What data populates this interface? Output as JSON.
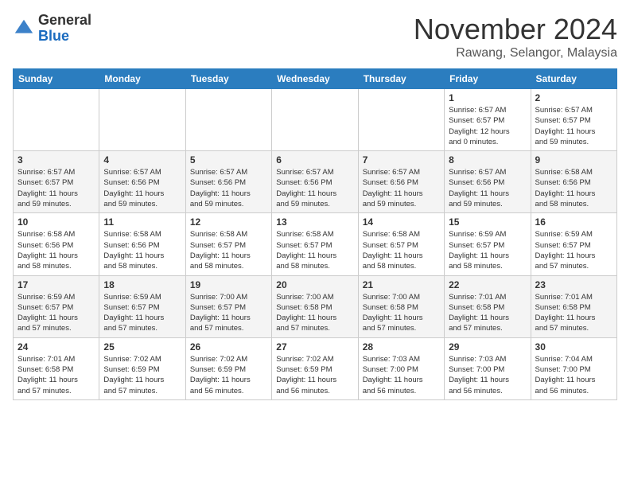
{
  "header": {
    "logo_general": "General",
    "logo_blue": "Blue",
    "month_title": "November 2024",
    "location": "Rawang, Selangor, Malaysia"
  },
  "days_of_week": [
    "Sunday",
    "Monday",
    "Tuesday",
    "Wednesday",
    "Thursday",
    "Friday",
    "Saturday"
  ],
  "weeks": [
    [
      {
        "day": "",
        "info": ""
      },
      {
        "day": "",
        "info": ""
      },
      {
        "day": "",
        "info": ""
      },
      {
        "day": "",
        "info": ""
      },
      {
        "day": "",
        "info": ""
      },
      {
        "day": "1",
        "info": "Sunrise: 6:57 AM\nSunset: 6:57 PM\nDaylight: 12 hours\nand 0 minutes."
      },
      {
        "day": "2",
        "info": "Sunrise: 6:57 AM\nSunset: 6:57 PM\nDaylight: 11 hours\nand 59 minutes."
      }
    ],
    [
      {
        "day": "3",
        "info": "Sunrise: 6:57 AM\nSunset: 6:57 PM\nDaylight: 11 hours\nand 59 minutes."
      },
      {
        "day": "4",
        "info": "Sunrise: 6:57 AM\nSunset: 6:56 PM\nDaylight: 11 hours\nand 59 minutes."
      },
      {
        "day": "5",
        "info": "Sunrise: 6:57 AM\nSunset: 6:56 PM\nDaylight: 11 hours\nand 59 minutes."
      },
      {
        "day": "6",
        "info": "Sunrise: 6:57 AM\nSunset: 6:56 PM\nDaylight: 11 hours\nand 59 minutes."
      },
      {
        "day": "7",
        "info": "Sunrise: 6:57 AM\nSunset: 6:56 PM\nDaylight: 11 hours\nand 59 minutes."
      },
      {
        "day": "8",
        "info": "Sunrise: 6:57 AM\nSunset: 6:56 PM\nDaylight: 11 hours\nand 59 minutes."
      },
      {
        "day": "9",
        "info": "Sunrise: 6:58 AM\nSunset: 6:56 PM\nDaylight: 11 hours\nand 58 minutes."
      }
    ],
    [
      {
        "day": "10",
        "info": "Sunrise: 6:58 AM\nSunset: 6:56 PM\nDaylight: 11 hours\nand 58 minutes."
      },
      {
        "day": "11",
        "info": "Sunrise: 6:58 AM\nSunset: 6:56 PM\nDaylight: 11 hours\nand 58 minutes."
      },
      {
        "day": "12",
        "info": "Sunrise: 6:58 AM\nSunset: 6:57 PM\nDaylight: 11 hours\nand 58 minutes."
      },
      {
        "day": "13",
        "info": "Sunrise: 6:58 AM\nSunset: 6:57 PM\nDaylight: 11 hours\nand 58 minutes."
      },
      {
        "day": "14",
        "info": "Sunrise: 6:58 AM\nSunset: 6:57 PM\nDaylight: 11 hours\nand 58 minutes."
      },
      {
        "day": "15",
        "info": "Sunrise: 6:59 AM\nSunset: 6:57 PM\nDaylight: 11 hours\nand 58 minutes."
      },
      {
        "day": "16",
        "info": "Sunrise: 6:59 AM\nSunset: 6:57 PM\nDaylight: 11 hours\nand 57 minutes."
      }
    ],
    [
      {
        "day": "17",
        "info": "Sunrise: 6:59 AM\nSunset: 6:57 PM\nDaylight: 11 hours\nand 57 minutes."
      },
      {
        "day": "18",
        "info": "Sunrise: 6:59 AM\nSunset: 6:57 PM\nDaylight: 11 hours\nand 57 minutes."
      },
      {
        "day": "19",
        "info": "Sunrise: 7:00 AM\nSunset: 6:57 PM\nDaylight: 11 hours\nand 57 minutes."
      },
      {
        "day": "20",
        "info": "Sunrise: 7:00 AM\nSunset: 6:58 PM\nDaylight: 11 hours\nand 57 minutes."
      },
      {
        "day": "21",
        "info": "Sunrise: 7:00 AM\nSunset: 6:58 PM\nDaylight: 11 hours\nand 57 minutes."
      },
      {
        "day": "22",
        "info": "Sunrise: 7:01 AM\nSunset: 6:58 PM\nDaylight: 11 hours\nand 57 minutes."
      },
      {
        "day": "23",
        "info": "Sunrise: 7:01 AM\nSunset: 6:58 PM\nDaylight: 11 hours\nand 57 minutes."
      }
    ],
    [
      {
        "day": "24",
        "info": "Sunrise: 7:01 AM\nSunset: 6:58 PM\nDaylight: 11 hours\nand 57 minutes."
      },
      {
        "day": "25",
        "info": "Sunrise: 7:02 AM\nSunset: 6:59 PM\nDaylight: 11 hours\nand 57 minutes."
      },
      {
        "day": "26",
        "info": "Sunrise: 7:02 AM\nSunset: 6:59 PM\nDaylight: 11 hours\nand 56 minutes."
      },
      {
        "day": "27",
        "info": "Sunrise: 7:02 AM\nSunset: 6:59 PM\nDaylight: 11 hours\nand 56 minutes."
      },
      {
        "day": "28",
        "info": "Sunrise: 7:03 AM\nSunset: 7:00 PM\nDaylight: 11 hours\nand 56 minutes."
      },
      {
        "day": "29",
        "info": "Sunrise: 7:03 AM\nSunset: 7:00 PM\nDaylight: 11 hours\nand 56 minutes."
      },
      {
        "day": "30",
        "info": "Sunrise: 7:04 AM\nSunset: 7:00 PM\nDaylight: 11 hours\nand 56 minutes."
      }
    ]
  ]
}
